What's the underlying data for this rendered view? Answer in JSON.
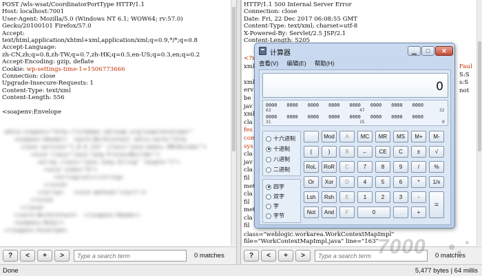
{
  "request": {
    "lines": [
      "POST /wls-wsat/CoordinatorPortType HTTP/1.1",
      "Host: localhost:7001",
      "User-Agent: Mozilla/5.0 (Windows NT 6.1; WOW64; rv:57.0)",
      "Gecko/20100101 Firefox/57.0",
      "Accept:",
      "text/html,application/xhtml+xml,application/xml;q=0.9,*/*;q=0.8",
      "Accept-Language:",
      "zh-CN,zh;q=0.8,zh-TW;q=0.7,zh-HK;q=0.5,en-US;q=0.3,en;q=0.2",
      "Accept-Encoding: gzip, deflate"
    ],
    "cookie_prefix": "Cookie: ",
    "cookie_value": "wp-settings-time-1=1506773666",
    "lines2": [
      "Connection: close",
      "Upgrade-Insecure-Requests: 1",
      "Content-Type: text/xml",
      "Content-Length: 556"
    ],
    "envelope": "<soapenv:Envelope"
  },
  "response": {
    "lines": [
      "HTTP/1.1 500 Internal Server Error",
      "Connection: close",
      "Date: Fri, 22 Dec 2017 06:08:55 GMT",
      "Content-Type: text/xml; charset=utf-8",
      "X-Powered-By: Servlet/2.5 JSP/2.1",
      "Content-Length: 5205"
    ],
    "left_fragments": [
      "<?x",
      "xml",
      "",
      "xml",
      "erv",
      "be",
      "jav",
      "xml",
      "cla",
      "fes",
      "com",
      "sys",
      "cla",
      "jav",
      "cla",
      "fil",
      "met",
      "cla",
      "fil",
      "met",
      "cla",
      "fil"
    ],
    "right_fragments": [
      "Faul",
      "S:S",
      "s:S",
      "not"
    ],
    "tail_line1": "class=\"weblogic.workarea.WorkContextMapImpl\"",
    "tail_line2": "file=\"WorkContextMapImpl.java\" line=\"163\""
  },
  "toolbar_left": {
    "help": "?",
    "prev": "<",
    "add": "+",
    "next": ">",
    "placeholder": "Type a search term",
    "matches": "0 matches"
  },
  "toolbar_right": {
    "help": "?",
    "prev": "<",
    "add": "+",
    "next": ">",
    "placeholder": "Type a search term",
    "matches": "0 matches"
  },
  "status": {
    "left": "Done",
    "right": "5,477 bytes | 64 millis"
  },
  "watermark": "7000",
  "calculator": {
    "title": "计算器",
    "menu": [
      "查看(V)",
      "编辑(E)",
      "帮助(H)"
    ],
    "display": "0",
    "bits": {
      "row1": [
        "0000",
        "0000",
        "0000",
        "0000",
        "0000",
        "0000",
        "0000",
        "0000"
      ],
      "row1_labels": [
        "63",
        "47",
        "32"
      ],
      "row2": [
        "0000",
        "0000",
        "0000",
        "0000",
        "0000",
        "0000",
        "0000",
        "0000"
      ],
      "row2_labels": [
        "31",
        "15",
        "0"
      ]
    },
    "radix": [
      "十六进制",
      "十进制",
      "八进制",
      "二进制"
    ],
    "radix_selected": 1,
    "word": [
      "四字",
      "双字",
      "字",
      "字节"
    ],
    "word_selected": 0,
    "keys": {
      "mod": "Mod",
      "a": "A",
      "mc": "MC",
      "mr": "MR",
      "ms": "MS",
      "mplus": "M+",
      "mminus": "M-",
      "lparen": "(",
      "rparen": ")",
      "b": "B",
      "back": "←",
      "ce": "CE",
      "c": "C",
      "pm": "±",
      "sqrt": "√",
      "rol": "RoL",
      "ror": "RoR",
      "cc": "C",
      "k7": "7",
      "k8": "8",
      "k9": "9",
      "div": "/",
      "pct": "%",
      "or": "Or",
      "xor": "Xor",
      "d": "D",
      "k4": "4",
      "k5": "5",
      "k6": "6",
      "mul": "*",
      "recip": "1/x",
      "lsh": "Lsh",
      "rsh": "Rsh",
      "e": "E",
      "k1": "1",
      "k2": "2",
      "k3": "3",
      "sub": "-",
      "eq": "=",
      "not": "Not",
      "and": "And",
      "f": "F",
      "k0": "0",
      "dot": ".",
      "add": "+"
    }
  }
}
